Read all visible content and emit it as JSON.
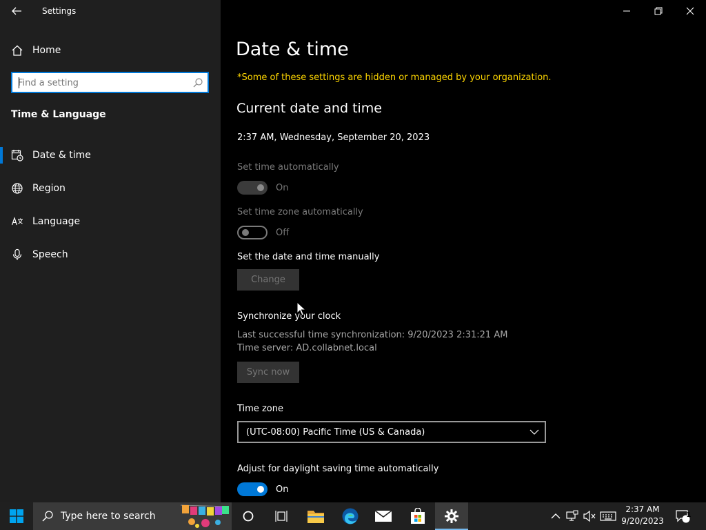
{
  "window": {
    "title": "Settings"
  },
  "sidebar": {
    "home_label": "Home",
    "search_placeholder": "Find a setting",
    "section_title": "Time & Language",
    "items": [
      {
        "label": "Date & time",
        "icon": "calendar-clock-icon",
        "selected": true
      },
      {
        "label": "Region",
        "icon": "globe-icon",
        "selected": false
      },
      {
        "label": "Language",
        "icon": "language-icon",
        "selected": false
      },
      {
        "label": "Speech",
        "icon": "microphone-icon",
        "selected": false
      }
    ]
  },
  "main": {
    "title": "Date & time",
    "org_note": "*Some of these settings are hidden or managed by your organization.",
    "current_heading": "Current date and time",
    "current_datetime": "2:37 AM, Wednesday, September 20, 2023",
    "set_time_auto": {
      "label": "Set time automatically",
      "state": "On",
      "on": true,
      "disabled": true
    },
    "set_tz_auto": {
      "label": "Set time zone automatically",
      "state": "Off",
      "on": false,
      "disabled": true
    },
    "manual": {
      "label": "Set the date and time manually",
      "button": "Change"
    },
    "sync": {
      "heading": "Synchronize your clock",
      "last_sync": "Last successful time synchronization: 9/20/2023 2:31:21 AM",
      "server": "Time server: AD.collabnet.local",
      "button": "Sync now"
    },
    "timezone": {
      "label": "Time zone",
      "value": "(UTC-08:00) Pacific Time (US & Canada)"
    },
    "dst": {
      "label": "Adjust for daylight saving time automatically",
      "state": "On",
      "on": true
    }
  },
  "taskbar": {
    "search_placeholder": "Type here to search",
    "time": "2:37 AM",
    "date": "9/20/2023",
    "notification_count": "1"
  },
  "colors": {
    "accent": "#0078d7",
    "warning_text": "#ffd700",
    "sidebar_bg": "#1f1f1f",
    "main_bg": "#000000",
    "taskbar_bg": "#202020"
  }
}
